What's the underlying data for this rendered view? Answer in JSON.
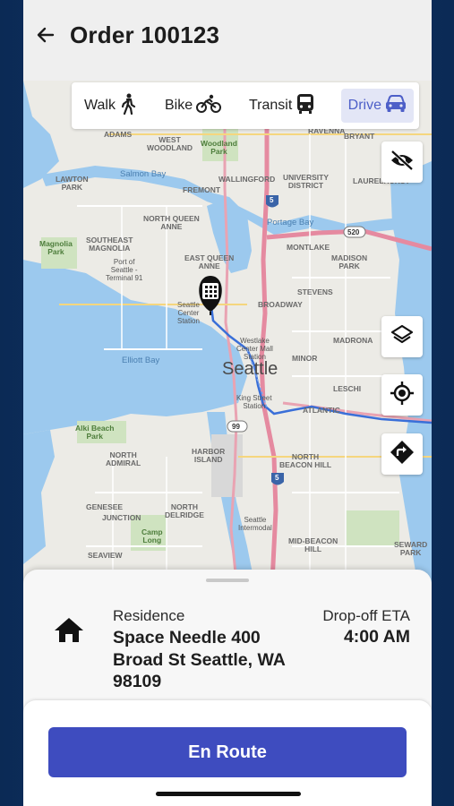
{
  "header": {
    "title": "Order 100123",
    "back_icon": "arrow-left-icon"
  },
  "travel_modes": [
    {
      "label": "Walk",
      "icon": "walk-icon",
      "active": false
    },
    {
      "label": "Bike",
      "icon": "bike-icon",
      "active": false
    },
    {
      "label": "Transit",
      "icon": "bus-icon",
      "active": false
    },
    {
      "label": "Drive",
      "icon": "car-icon",
      "active": true
    }
  ],
  "map": {
    "labels": {
      "adams": "ADAMS",
      "west_woodland": "WEST\nWOODLAND",
      "woodland_park": "Woodland\nPark",
      "ravenna": "RAVENNA",
      "bryant": "BRYANT",
      "lawton_park": "LAWTON\nPARK",
      "salmon_bay": "Salmon Bay",
      "wallingford": "WALLINGFORD",
      "university_district": "UNIVERSITY\nDISTRICT",
      "laurelhurst": "LAURELHURST",
      "fremont": "FREMONT",
      "north_queen_anne": "NORTH QUEEN\nANNE",
      "portage_bay": "Portage Bay",
      "southeast_magnolia": "SOUTHEAST\nMAGNOLIA",
      "magnolia_park": "Magnolia\nPark",
      "montlake": "MONTLAKE",
      "port_of_seattle": "Port of\nSeattle -\nTerminal 91",
      "east_queen_anne": "EAST QUEEN\nANNE",
      "madison_park": "MADISON\nPARK",
      "stevens": "STEVENS",
      "broadway": "BROADWAY",
      "seattle_center": "Seattle\nCenter\nStation",
      "westlake": "Westlake\nCenter Mall\nStation",
      "madrona": "MADRONA",
      "elliott_bay": "Elliott Bay",
      "minor": "MINOR",
      "seattle": "Seattle",
      "leschi": "LESCHI",
      "king_street": "King Street\nStation",
      "atlantic": "ATLANTIC",
      "alki_beach": "Alki Beach\nPark",
      "harbor_island": "HARBOR\nISLAND",
      "north_admiral": "NORTH\nADMIRAL",
      "north_beacon_hill": "NORTH\nBEACON HILL",
      "genesee": "GENESEE",
      "junction": "JUNCTION",
      "north_delridge": "NORTH\nDELRIDGE",
      "camp_long": "Camp\nLong",
      "seattle_intermodal": "Seattle\nIntermodal",
      "seaview": "SEAVIEW",
      "mid_beacon_hill": "MID-BEACON\nHILL",
      "seward_park": "SEWARD\nPARK",
      "i5_north": "5",
      "i5_south": "5",
      "sr520": "520",
      "i99": "99"
    }
  },
  "map_controls": [
    {
      "name": "hide-visibility",
      "icon": "eye-off-icon"
    },
    {
      "name": "layers",
      "icon": "layers-icon"
    },
    {
      "name": "my-location",
      "icon": "locate-icon"
    },
    {
      "name": "directions",
      "icon": "directions-icon"
    }
  ],
  "destination": {
    "type": "Residence",
    "address": "Space Needle 400 Broad St Seattle, WA 98109",
    "eta_label": "Drop-off ETA",
    "eta_value": "4:00 AM"
  },
  "action": {
    "button_label": "En Route"
  },
  "colors": {
    "primary": "#3e4cbf",
    "active_mode_bg": "#e3e6f6",
    "route": "#3a6fd8",
    "water": "#9cc9ee"
  }
}
